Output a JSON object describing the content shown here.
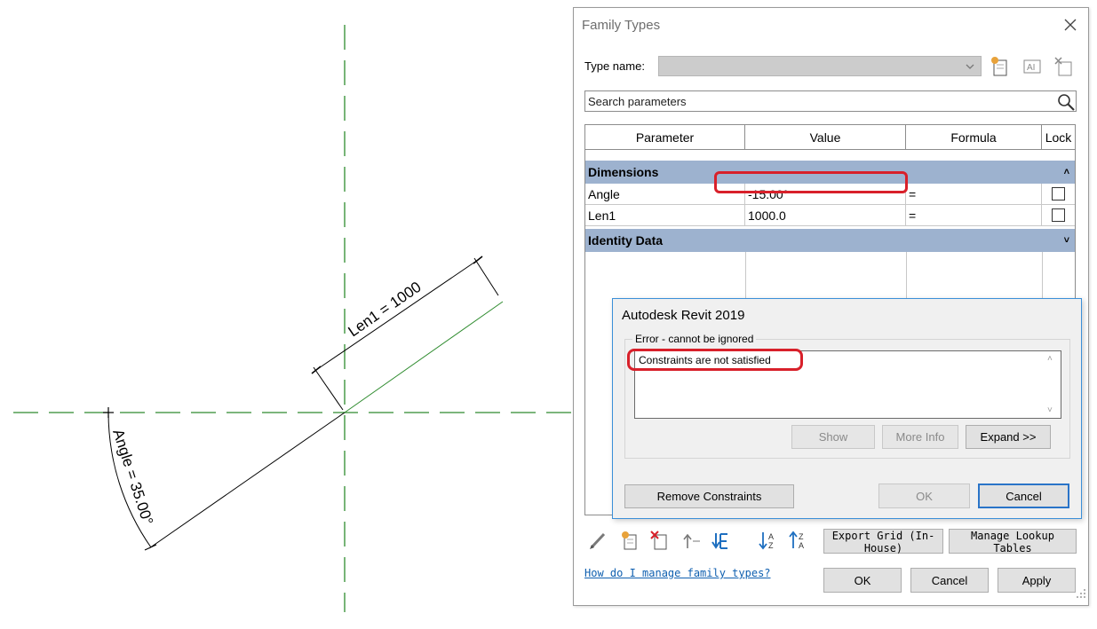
{
  "canvas": {
    "dimensions": {
      "length": "Len1 = 1000",
      "angle": "Angle = 35.00°"
    }
  },
  "family_types": {
    "title": "Family Types",
    "type_name_label": "Type name:",
    "type_name_value": "",
    "search_placeholder": "Search parameters",
    "columns": [
      "Parameter",
      "Value",
      "Formula",
      "Lock"
    ],
    "groups": [
      {
        "name": "Dimensions",
        "expanded": true,
        "rows": [
          {
            "parameter": "Angle",
            "value": "-15.00°",
            "formula": "=",
            "locked": false
          },
          {
            "parameter": "Len1",
            "value": "1000.0",
            "formula": "=",
            "locked": false
          }
        ]
      },
      {
        "name": "Identity Data",
        "expanded": false,
        "rows": []
      }
    ],
    "buttons": {
      "export_grid": "Export Grid (In-House)",
      "manage_lookup": "Manage Lookup Tables",
      "ok": "OK",
      "cancel": "Cancel",
      "apply": "Apply"
    },
    "help_link": "How do I manage family types?"
  },
  "error_dialog": {
    "title": "Autodesk Revit 2019",
    "group_label": "Error - cannot be ignored",
    "message": "Constraints are not satisfied",
    "buttons": {
      "show": "Show",
      "more_info": "More Info",
      "expand": "Expand >>",
      "remove_constraints": "Remove Constraints",
      "ok": "OK",
      "cancel": "Cancel"
    }
  },
  "colors": {
    "group_header": "#9db2cf",
    "highlight": "#d8202a",
    "reference_line": "#2e8b2e",
    "focus_border": "#2a74c8"
  }
}
